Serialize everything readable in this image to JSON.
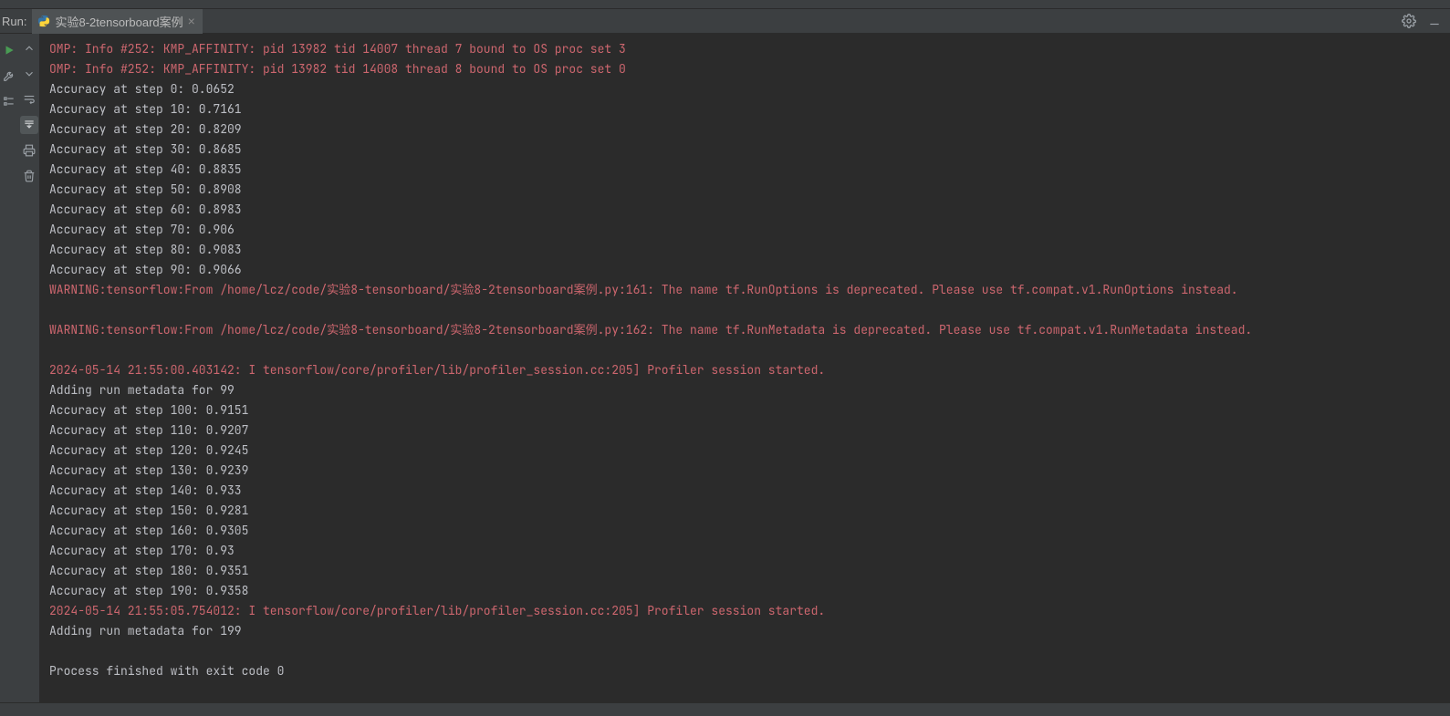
{
  "header": {
    "run_label": "Run:",
    "tab_name": "实验8-2tensorboard案例"
  },
  "console_lines": [
    {
      "cls": "err",
      "text": "OMP: Info #252: KMP_AFFINITY: pid 13982 tid 14007 thread 7 bound to OS proc set 3"
    },
    {
      "cls": "err",
      "text": "OMP: Info #252: KMP_AFFINITY: pid 13982 tid 14008 thread 8 bound to OS proc set 0"
    },
    {
      "cls": "out",
      "text": "Accuracy at step 0: 0.0652"
    },
    {
      "cls": "out",
      "text": "Accuracy at step 10: 0.7161"
    },
    {
      "cls": "out",
      "text": "Accuracy at step 20: 0.8209"
    },
    {
      "cls": "out",
      "text": "Accuracy at step 30: 0.8685"
    },
    {
      "cls": "out",
      "text": "Accuracy at step 40: 0.8835"
    },
    {
      "cls": "out",
      "text": "Accuracy at step 50: 0.8908"
    },
    {
      "cls": "out",
      "text": "Accuracy at step 60: 0.8983"
    },
    {
      "cls": "out",
      "text": "Accuracy at step 70: 0.906"
    },
    {
      "cls": "out",
      "text": "Accuracy at step 80: 0.9083"
    },
    {
      "cls": "out",
      "text": "Accuracy at step 90: 0.9066"
    },
    {
      "cls": "err",
      "text": "WARNING:tensorflow:From /home/lcz/code/实验8-tensorboard/实验8-2tensorboard案例.py:161: The name tf.RunOptions is deprecated. Please use tf.compat.v1.RunOptions instead."
    },
    {
      "cls": "err",
      "text": ""
    },
    {
      "cls": "err",
      "text": "WARNING:tensorflow:From /home/lcz/code/实验8-tensorboard/实验8-2tensorboard案例.py:162: The name tf.RunMetadata is deprecated. Please use tf.compat.v1.RunMetadata instead."
    },
    {
      "cls": "err",
      "text": ""
    },
    {
      "cls": "err",
      "text": "2024-05-14 21:55:00.403142: I tensorflow/core/profiler/lib/profiler_session.cc:205] Profiler session started."
    },
    {
      "cls": "out",
      "text": "Adding run metadata for 99"
    },
    {
      "cls": "out",
      "text": "Accuracy at step 100: 0.9151"
    },
    {
      "cls": "out",
      "text": "Accuracy at step 110: 0.9207"
    },
    {
      "cls": "out",
      "text": "Accuracy at step 120: 0.9245"
    },
    {
      "cls": "out",
      "text": "Accuracy at step 130: 0.9239"
    },
    {
      "cls": "out",
      "text": "Accuracy at step 140: 0.933"
    },
    {
      "cls": "out",
      "text": "Accuracy at step 150: 0.9281"
    },
    {
      "cls": "out",
      "text": "Accuracy at step 160: 0.9305"
    },
    {
      "cls": "out",
      "text": "Accuracy at step 170: 0.93"
    },
    {
      "cls": "out",
      "text": "Accuracy at step 180: 0.9351"
    },
    {
      "cls": "out",
      "text": "Accuracy at step 190: 0.9358"
    },
    {
      "cls": "err",
      "text": "2024-05-14 21:55:05.754012: I tensorflow/core/profiler/lib/profiler_session.cc:205] Profiler session started."
    },
    {
      "cls": "out",
      "text": "Adding run metadata for 199"
    },
    {
      "cls": "out",
      "text": ""
    },
    {
      "cls": "out",
      "text": "Process finished with exit code 0"
    }
  ]
}
